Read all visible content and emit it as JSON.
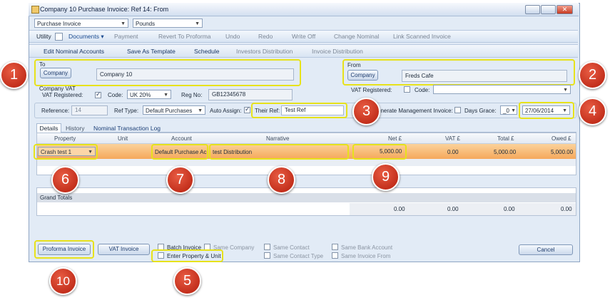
{
  "window": {
    "title": "Company 10 Purchase Invoice: Ref 14: From"
  },
  "top_combos": {
    "invoice_type": "Purchase Invoice",
    "currency": "Pounds"
  },
  "toolbar1": {
    "utility": "Utility",
    "documents": "Documents",
    "payment": "Payment",
    "revert": "Revert To Proforma",
    "undo": "Undo",
    "redo": "Redo",
    "write_off": "Write Off",
    "change_nominal": "Change Nominal",
    "link_scanned": "Link Scanned Invoice"
  },
  "toolbar2": {
    "edit_nominal": "Edit Nominal Accounts",
    "save_template": "Save As Template",
    "schedule": "Schedule",
    "investors_dist": "Investors Distribution",
    "invoice_dist": "Invoice Distribution"
  },
  "to": {
    "label": "To",
    "button": "Company",
    "value": "Company 10",
    "vat_label": "Company VAT"
  },
  "from": {
    "label": "From",
    "button": "Company",
    "value": "Freds Cafe"
  },
  "vat_row": {
    "vat_registered": "VAT Registered:",
    "code_label": "Code:",
    "code_value": "UK 20%",
    "reg_label": "Reg No:",
    "reg_value": "GB12345678"
  },
  "from_vat_row": {
    "vat_registered": "VAT Registered:",
    "code_label": "Code:"
  },
  "ref_row": {
    "reference_label": "Reference:",
    "reference_value": "14",
    "ref_type_label": "Ref Type:",
    "ref_type_value": "Default Purchases",
    "auto_assign": "Auto Assign:",
    "their_ref_label": "Their Ref:",
    "their_ref_value": "Test Ref",
    "generate_mgmt": "enerate Management Invoice:",
    "days_grace": "Days Grace:",
    "days_value": "_0",
    "date": "27/06/2014"
  },
  "tabs": [
    "Details",
    "History",
    "Nominal Transaction Log"
  ],
  "columns": [
    "Property",
    "Unit",
    "Account",
    "Narrative",
    "Net £",
    "VAT £",
    "Total £",
    "Owed £"
  ],
  "row": {
    "property": "Crash test 1",
    "unit": "",
    "account": "Default Purchase Ac",
    "narrative": "test Distribution",
    "net": "5,000.00",
    "vat": "0.00",
    "total": "5,000.00",
    "owed": "5,000.00"
  },
  "totals": {
    "label": "Grand Totals",
    "net": "0.00",
    "vat": "0.00",
    "total": "0.00",
    "owed": "0.00"
  },
  "bottom": {
    "proforma": "Proforma Invoice",
    "vat_invoice": "VAT Invoice",
    "batch_invoice": "Batch Invoice",
    "same_company": "Same Company",
    "enter_property": "Enter Property & Unit",
    "same_contact": "Same Contact",
    "same_contact_type": "Same Contact Type",
    "same_bank": "Same Bank Account",
    "same_invoice_from": "Same Invoice From",
    "cancel": "Cancel"
  },
  "callouts": [
    "1",
    "2",
    "3",
    "4",
    "5",
    "6",
    "7",
    "8",
    "9",
    "10"
  ],
  "colors": {
    "highlight": "#e7e21a",
    "badge": "#c62a14",
    "row": "#f7b46a"
  }
}
